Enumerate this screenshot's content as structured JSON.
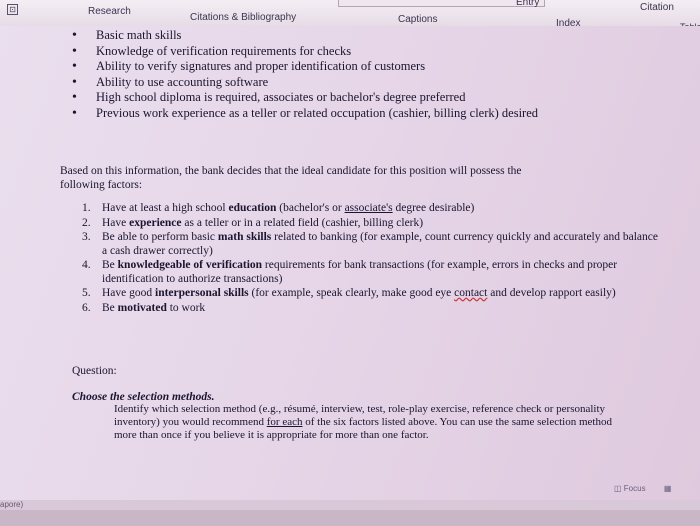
{
  "ribbon": {
    "entry": "Entry",
    "citation": "Citation",
    "table": "Table",
    "research": "Research",
    "citations_bibliography": "Citations & Bibliography",
    "captions": "Captions",
    "index": "Index"
  },
  "bullets": [
    "Basic math skills",
    "Knowledge of verification requirements for checks",
    "Ability to verify signatures and proper identification of customers",
    "Ability to use accounting software",
    "High school diploma is required, associates or bachelor's degree preferred",
    "Previous work experience as a teller or related occupation (cashier, billing clerk) desired"
  ],
  "intro": {
    "line1": "Based on this information, the bank decides that the ideal candidate for this position will possess the",
    "line2": "following factors:"
  },
  "factors": [
    {
      "num": "1.",
      "a": "Have at least a high school ",
      "b": "education",
      "c": " (bachelor's or ",
      "d": "associate's",
      "e": " degree desirable)"
    },
    {
      "num": "2.",
      "a": "Have ",
      "b": "experience",
      "c": " as a teller or in a related field (cashier, billing clerk)"
    },
    {
      "num": "3.",
      "a": "Be able to perform basic ",
      "b": "math skills",
      "c": " related to banking (for example, count currency quickly and accurately and balance a cash drawer correctly)"
    },
    {
      "num": "4.",
      "a": "Be ",
      "b": "knowledgeable of verification",
      "c": " requirements for bank transactions (for example, errors in checks and proper identification to authorize transactions)"
    },
    {
      "num": "5.",
      "a": "Have good ",
      "b": "interpersonal skills",
      "c": " (for example, speak clearly, make good eye ",
      "d": "contact",
      "e": " and develop rapport easily)"
    },
    {
      "num": "6.",
      "a": "Be ",
      "b": "motivated",
      "c": " to work"
    }
  ],
  "question_label": "Question:",
  "question_title": "Choose the selection methods.",
  "question_body": {
    "a": "Identify which selection method (e.g., résumé, interview, test, role-play exercise, reference check or personality inventory) you would recommend ",
    "b": "for each",
    "c": " of the six factors listed above. You can use the same selection method more than once if you believe it is appropriate for more than one factor."
  },
  "status": {
    "focus": "Focus",
    "left": "apore)"
  }
}
